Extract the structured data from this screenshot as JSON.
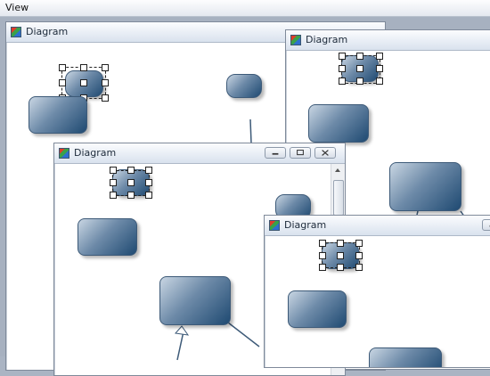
{
  "menubar": {
    "view_label": "View"
  },
  "windows": [
    {
      "title": "Diagram"
    },
    {
      "title": "Diagram"
    },
    {
      "title": "Diagram"
    },
    {
      "title": "Diagram"
    }
  ],
  "colors": {
    "node_dark": "#1f4a72",
    "node_light": "#c9d6e3",
    "workspace": "#a7b1c0"
  },
  "icons": [
    "diagram-app-icon",
    "minimize-icon",
    "restore-icon",
    "close-icon"
  ]
}
